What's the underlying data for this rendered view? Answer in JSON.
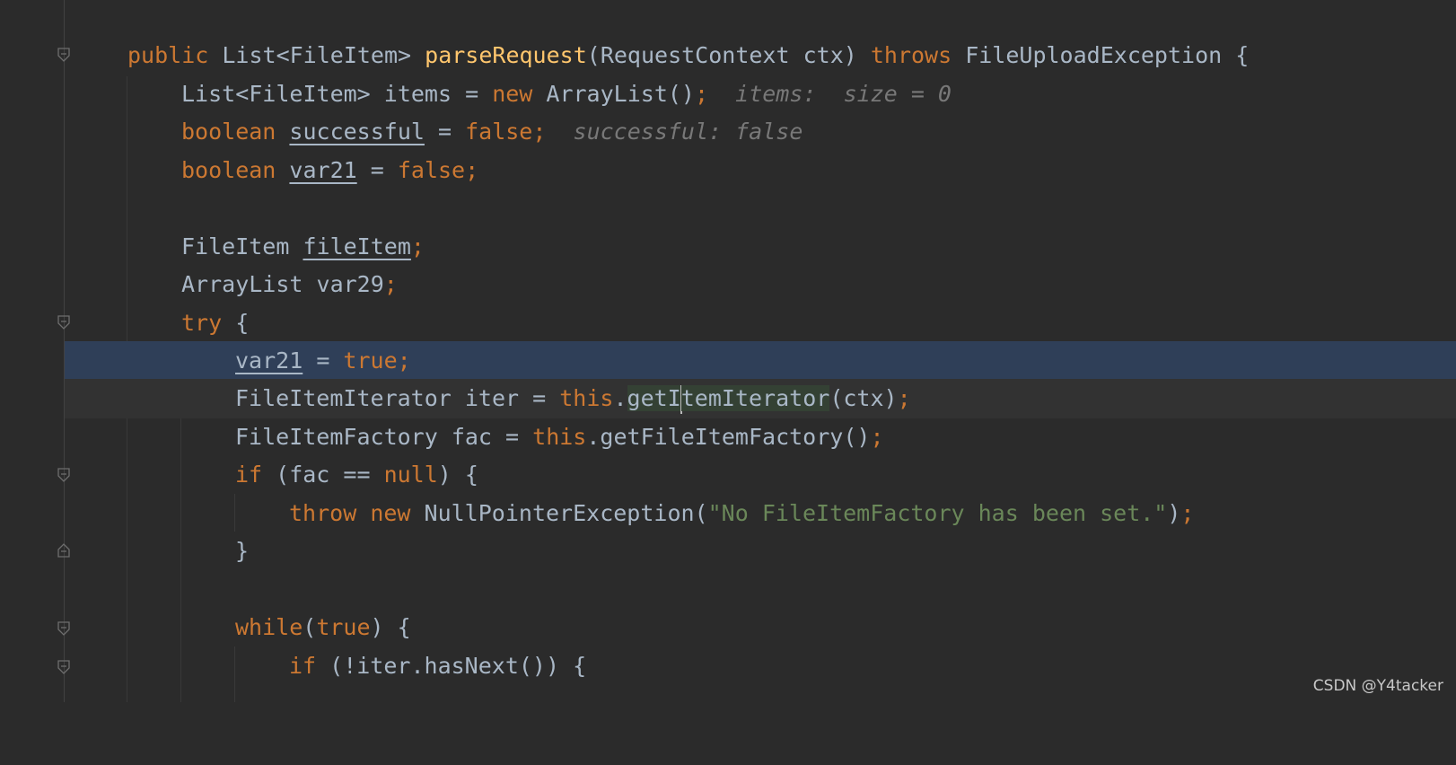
{
  "editor": {
    "colors": {
      "background": "#2b2b2b",
      "keyword": "#cc7832",
      "method": "#ffc66d",
      "string": "#6a8759",
      "text": "#a9b7c6",
      "execution_line": "#2f3f58",
      "inlay_hint": "#787878"
    },
    "lines": [
      {
        "t1": "public ",
        "t2": "List<FileItem> ",
        "t3": "parseRequest",
        "t4": "(RequestContext ctx) ",
        "t5": "throws ",
        "t6": "FileUploadException {"
      },
      {
        "t1": "List<FileItem> items = ",
        "t2": "new ",
        "t3": "ArrayList()",
        "t4": ";",
        "hint": "items:  size = 0"
      },
      {
        "t1": "boolean ",
        "t2": "successful",
        "t3": " = ",
        "t4": "false;",
        "hint": "successful: false"
      },
      {
        "t1": "boolean ",
        "t2": "var21",
        "t3": " = ",
        "t4": "false;"
      },
      {
        "t1": "FileItem ",
        "t2": "fileItem",
        "t3": ";"
      },
      {
        "t1": "ArrayList var29",
        "t2": ";"
      },
      {
        "t1": "try ",
        "t2": "{"
      },
      {
        "t1": "var21",
        "t2": " = ",
        "t3": "true;"
      },
      {
        "t1": "FileItemIterator iter = ",
        "t2": "this",
        "t3": ".",
        "t4": "getI",
        "t5": "temIterator",
        "t6": "(ctx)",
        "t7": ";"
      },
      {
        "t1": "FileItemFactory fac = ",
        "t2": "this",
        "t3": ".getFileItemFactory()",
        "t4": ";"
      },
      {
        "t1": "if ",
        "t2": "(fac == ",
        "t3": "null",
        "t4": ") {"
      },
      {
        "t1": "throw ",
        "t2": "new ",
        "t3": "NullPointerException(",
        "t4": "\"No FileItemFactory has been set.\"",
        "t5": ")",
        "t6": ";"
      },
      {
        "t1": "}"
      },
      {
        "t1": "while",
        "t2": "(",
        "t3": "true",
        "t4": ") {"
      },
      {
        "t1": "if ",
        "t2": "(!iter.hasNext()) {"
      }
    ]
  },
  "watermark": "CSDN @Y4tacker"
}
